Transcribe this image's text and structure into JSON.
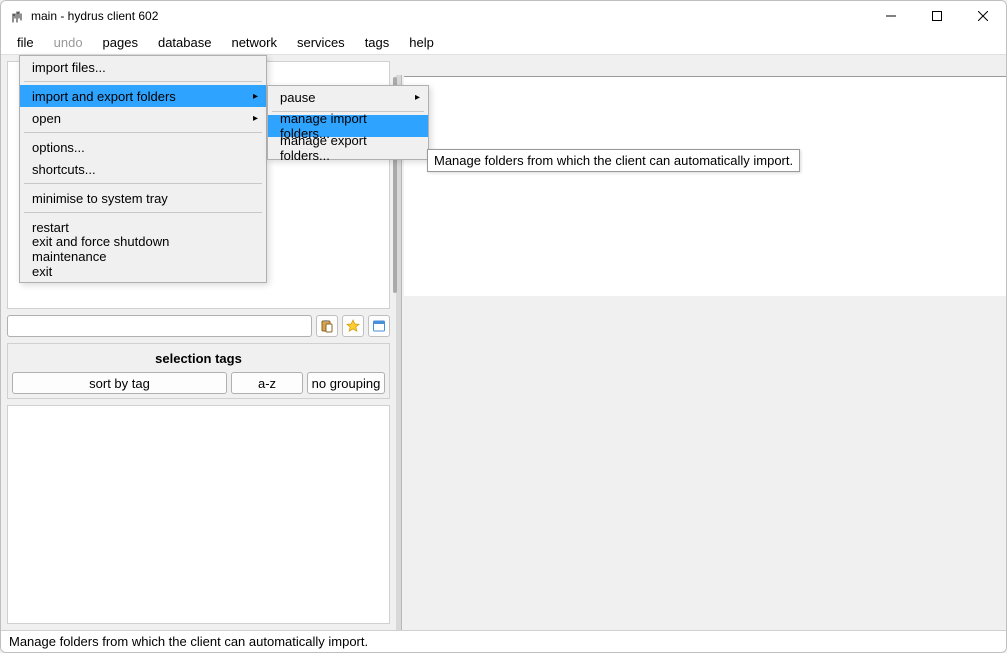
{
  "window": {
    "title": "main - hydrus client 602"
  },
  "menubar": [
    "file",
    "undo",
    "pages",
    "database",
    "network",
    "services",
    "tags",
    "help"
  ],
  "file_menu": {
    "items": [
      {
        "label": "import files...",
        "sep_after": true
      },
      {
        "label": "import and export folders",
        "submenu": true,
        "highlight": true,
        "sep_after": false
      },
      {
        "label": "open",
        "submenu": true,
        "sep_after": true
      },
      {
        "label": "options...",
        "sep_after": false
      },
      {
        "label": "shortcuts...",
        "sep_after": true
      },
      {
        "label": "minimise to system tray",
        "sep_after": true
      },
      {
        "label": "restart",
        "sep_after": false
      },
      {
        "label": "exit and force shutdown maintenance",
        "sep_after": false
      },
      {
        "label": "exit",
        "sep_after": false
      }
    ]
  },
  "submenu": {
    "items": [
      {
        "label": "pause",
        "submenu": true,
        "sep_after": true
      },
      {
        "label": "manage import folders...",
        "highlight": true
      },
      {
        "label": "manage export folders..."
      }
    ]
  },
  "tooltip": "Manage folders from which the client can automatically import.",
  "left_panel": {
    "section_label": "selection tags",
    "sort_btn": "sort by tag",
    "az_btn": "a-z",
    "group_btn": "no grouping"
  },
  "statusbar": "Manage folders from which the client can automatically import."
}
